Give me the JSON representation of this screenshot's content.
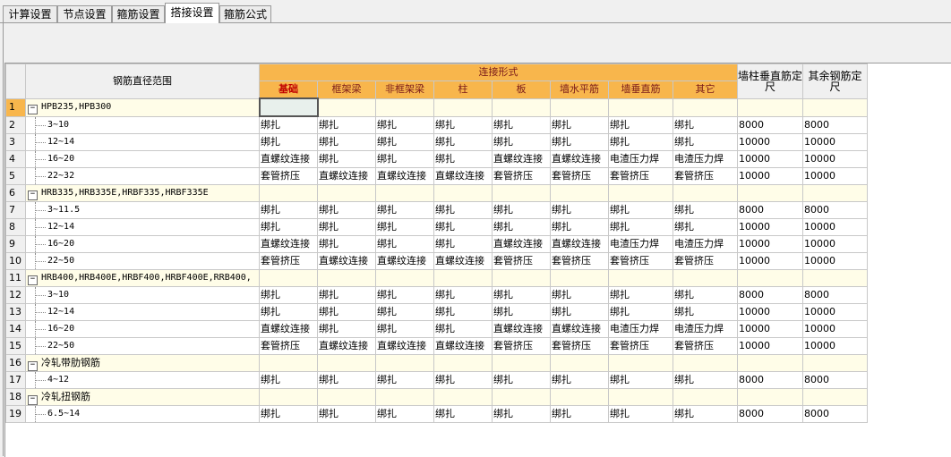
{
  "tabs": [
    "计算设置",
    "节点设置",
    "箍筋设置",
    "搭接设置",
    "箍筋公式"
  ],
  "active_tab": "搭接设置",
  "headers": {
    "range": "钢筋直径范围",
    "connection": "连接形式",
    "sub": [
      "基础",
      "框架梁",
      "非框架梁",
      "柱",
      "板",
      "墙水平筋",
      "墙垂直筋",
      "其它"
    ],
    "wall_len": "墙柱垂直筋定尺",
    "other_len": "其余钢筋定尺"
  },
  "rows": [
    {
      "num": "1",
      "group": true,
      "name": "HPB235,HPB300",
      "cjk": false
    },
    {
      "num": "2",
      "group": false,
      "name": "3~10",
      "vals": [
        "绑扎",
        "绑扎",
        "绑扎",
        "绑扎",
        "绑扎",
        "绑扎",
        "绑扎",
        "绑扎",
        "8000",
        "8000"
      ]
    },
    {
      "num": "3",
      "group": false,
      "name": "12~14",
      "vals": [
        "绑扎",
        "绑扎",
        "绑扎",
        "绑扎",
        "绑扎",
        "绑扎",
        "绑扎",
        "绑扎",
        "10000",
        "10000"
      ]
    },
    {
      "num": "4",
      "group": false,
      "name": "16~20",
      "vals": [
        "直螺纹连接",
        "绑扎",
        "绑扎",
        "绑扎",
        "直螺纹连接",
        "直螺纹连接",
        "电渣压力焊",
        "电渣压力焊",
        "10000",
        "10000"
      ]
    },
    {
      "num": "5",
      "group": false,
      "name": "22~32",
      "vals": [
        "套管挤压",
        "直螺纹连接",
        "直螺纹连接",
        "直螺纹连接",
        "套管挤压",
        "套管挤压",
        "套管挤压",
        "套管挤压",
        "10000",
        "10000"
      ]
    },
    {
      "num": "6",
      "group": true,
      "name": "HRB335,HRB335E,HRBF335,HRBF335E",
      "cjk": false
    },
    {
      "num": "7",
      "group": false,
      "name": "3~11.5",
      "vals": [
        "绑扎",
        "绑扎",
        "绑扎",
        "绑扎",
        "绑扎",
        "绑扎",
        "绑扎",
        "绑扎",
        "8000",
        "8000"
      ]
    },
    {
      "num": "8",
      "group": false,
      "name": "12~14",
      "vals": [
        "绑扎",
        "绑扎",
        "绑扎",
        "绑扎",
        "绑扎",
        "绑扎",
        "绑扎",
        "绑扎",
        "10000",
        "10000"
      ]
    },
    {
      "num": "9",
      "group": false,
      "name": "16~20",
      "vals": [
        "直螺纹连接",
        "绑扎",
        "绑扎",
        "绑扎",
        "直螺纹连接",
        "直螺纹连接",
        "电渣压力焊",
        "电渣压力焊",
        "10000",
        "10000"
      ]
    },
    {
      "num": "10",
      "group": false,
      "name": "22~50",
      "vals": [
        "套管挤压",
        "直螺纹连接",
        "直螺纹连接",
        "直螺纹连接",
        "套管挤压",
        "套管挤压",
        "套管挤压",
        "套管挤压",
        "10000",
        "10000"
      ]
    },
    {
      "num": "11",
      "group": true,
      "name": "HRB400,HRB400E,HRBF400,HRBF400E,RRB400,",
      "cjk": false
    },
    {
      "num": "12",
      "group": false,
      "name": "3~10",
      "vals": [
        "绑扎",
        "绑扎",
        "绑扎",
        "绑扎",
        "绑扎",
        "绑扎",
        "绑扎",
        "绑扎",
        "8000",
        "8000"
      ]
    },
    {
      "num": "13",
      "group": false,
      "name": "12~14",
      "vals": [
        "绑扎",
        "绑扎",
        "绑扎",
        "绑扎",
        "绑扎",
        "绑扎",
        "绑扎",
        "绑扎",
        "10000",
        "10000"
      ]
    },
    {
      "num": "14",
      "group": false,
      "name": "16~20",
      "vals": [
        "直螺纹连接",
        "绑扎",
        "绑扎",
        "绑扎",
        "直螺纹连接",
        "直螺纹连接",
        "电渣压力焊",
        "电渣压力焊",
        "10000",
        "10000"
      ]
    },
    {
      "num": "15",
      "group": false,
      "name": "22~50",
      "vals": [
        "套管挤压",
        "直螺纹连接",
        "直螺纹连接",
        "直螺纹连接",
        "套管挤压",
        "套管挤压",
        "套管挤压",
        "套管挤压",
        "10000",
        "10000"
      ]
    },
    {
      "num": "16",
      "group": true,
      "name": "冷轧带肋钢筋",
      "cjk": true
    },
    {
      "num": "17",
      "group": false,
      "name": "4~12",
      "vals": [
        "绑扎",
        "绑扎",
        "绑扎",
        "绑扎",
        "绑扎",
        "绑扎",
        "绑扎",
        "绑扎",
        "8000",
        "8000"
      ]
    },
    {
      "num": "18",
      "group": true,
      "name": "冷轧扭钢筋",
      "cjk": true
    },
    {
      "num": "19",
      "group": false,
      "name": "6.5~14",
      "vals": [
        "绑扎",
        "绑扎",
        "绑扎",
        "绑扎",
        "绑扎",
        "绑扎",
        "绑扎",
        "绑扎",
        "8000",
        "8000"
      ]
    }
  ],
  "colors": {
    "header_accent": "#f8b64c",
    "group_row": "#fffde8"
  }
}
